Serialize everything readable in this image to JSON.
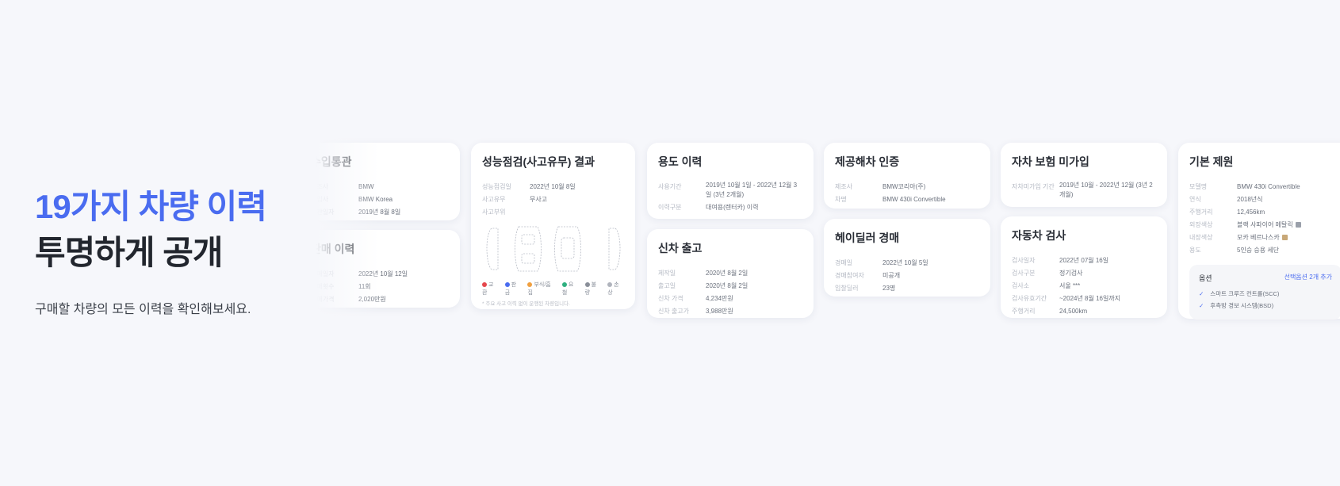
{
  "hero": {
    "title_line1": "19가지 차량 이력",
    "title_line2": "투명하게 공개",
    "subtitle": "구매할 차량의 모든 이력을 확인해보세요."
  },
  "cards": {
    "import": {
      "title": "수입통관",
      "rows": [
        {
          "k": "제조사",
          "v": "BMW"
        },
        {
          "k": "수입사",
          "v": "BMW Korea"
        },
        {
          "k": "통관일자",
          "v": "2019년 8월 8일"
        }
      ]
    },
    "sales": {
      "title": "판매 이력",
      "rows": [
        {
          "k": "판매일자",
          "v": "2022년 10월 12일"
        },
        {
          "k": "판매횟수",
          "v": "11회"
        },
        {
          "k": "판매가격",
          "v": "2,020만원"
        }
      ]
    },
    "inspection": {
      "title": "성능점검(사고유무) 결과",
      "rows": [
        {
          "k": "성능점검일",
          "v": "2022년 10월 8일"
        },
        {
          "k": "사고유무",
          "v": "무사고"
        },
        {
          "k": "사고부위",
          "v": ""
        }
      ],
      "legend": [
        "교환",
        "판금",
        "부식/흠집",
        "요철",
        "불량",
        "손상"
      ],
      "legend_colors": [
        "#e5484d",
        "#4a6cf0",
        "#f0a040",
        "#30b080",
        "#8a8f99",
        "#b0b4bd"
      ],
      "note": "* 주요 사고 이력 없이 운행된 차량입니다."
    },
    "usage": {
      "title": "용도 이력",
      "rows": [
        {
          "k": "사용기간",
          "v": "2019년 10월 1일 - 2022년 12월 3일 (3년 2개월)"
        },
        {
          "k": "이력구분",
          "v": "대여용(렌터카) 이력"
        }
      ]
    },
    "new_car": {
      "title": "신차 출고",
      "rows": [
        {
          "k": "제작일",
          "v": "2020년 8월 2일"
        },
        {
          "k": "출고일",
          "v": "2020년 8월 2일"
        },
        {
          "k": "신차 가격",
          "v": "4,234만원"
        },
        {
          "k": "신차 출고가",
          "v": "3,988만원"
        }
      ]
    },
    "certified": {
      "title": "제공해차 인증",
      "rows": [
        {
          "k": "제조사",
          "v": "BMW코리아(주)"
        },
        {
          "k": "차명",
          "v": "BMW 430i Convertible"
        }
      ]
    },
    "auction": {
      "title": "헤이딜러 경매",
      "rows": [
        {
          "k": "경매일",
          "v": "2022년 10월 5일"
        },
        {
          "k": "경매참여자",
          "v": "미공개"
        },
        {
          "k": "입찰딜러",
          "v": "23명"
        }
      ]
    },
    "insurance": {
      "title": "자차 보험 미가입",
      "rows": [
        {
          "k": "자차미가입 기간",
          "v": "2019년 10월 - 2022년 12월 (3년 2개월)"
        }
      ]
    },
    "vehicle_check": {
      "title": "자동차 검사",
      "rows": [
        {
          "k": "검사일자",
          "v": "2022년 07월 16일"
        },
        {
          "k": "검사구분",
          "v": "정기검사"
        },
        {
          "k": "검사소",
          "v": "서울 ***"
        },
        {
          "k": "검사유효기간",
          "v": "~2024년 8월 16일까지"
        },
        {
          "k": "주행거리",
          "v": "24,500km"
        }
      ]
    },
    "spec": {
      "title": "기본 제원",
      "rows": [
        {
          "k": "모델명",
          "v": "BMW 430i Convertible"
        },
        {
          "k": "연식",
          "v": "2018년식"
        },
        {
          "k": "주행거리",
          "v": "12,456km"
        },
        {
          "k": "외장색상",
          "v": "블랙 사파이어 메탈릭"
        },
        {
          "k": "내장색상",
          "v": "모카 베르나스카"
        },
        {
          "k": "용도",
          "v": "5인승 승용 세단"
        }
      ],
      "options": {
        "label": "옵션",
        "link": "선택옵션 2개 추가",
        "items": [
          "스마트 크루즈 컨트롤(SCC)",
          "후측방 경보 시스템(BSD)"
        ]
      }
    }
  }
}
